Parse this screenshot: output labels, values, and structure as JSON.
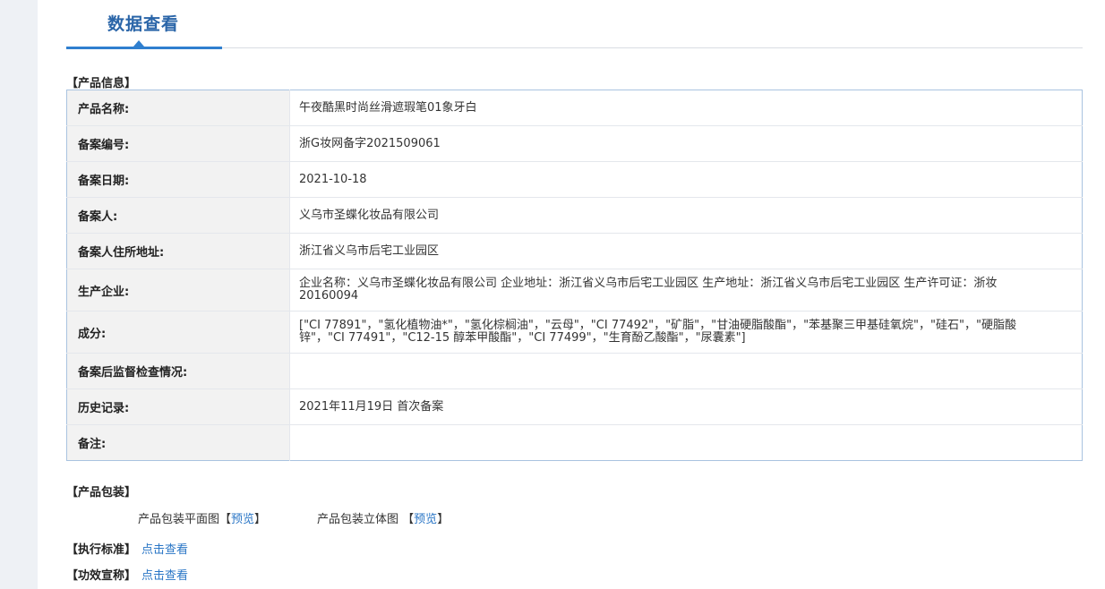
{
  "tab": {
    "title": "数据查看"
  },
  "sections": {
    "product_info": "【产品信息】",
    "packaging": "【产品包装】",
    "standard": "【执行标准】",
    "efficacy": "【功效宣称】"
  },
  "product_info_rows": [
    {
      "key": "产品名称:",
      "value": "午夜酷黑时尚丝滑遮瑕笔01象牙白"
    },
    {
      "key": "备案编号:",
      "value": "浙G妆网备字2021509061"
    },
    {
      "key": "备案日期:",
      "value": "2021-10-18"
    },
    {
      "key": "备案人:",
      "value": "义乌市圣蝶化妆品有限公司"
    },
    {
      "key": "备案人住所地址:",
      "value": "浙江省义乌市后宅工业园区"
    },
    {
      "key": "生产企业:",
      "value": "企业名称：义乌市圣蝶化妆品有限公司 企业地址：浙江省义乌市后宅工业园区 生产地址：浙江省义乌市后宅工业园区 生产许可证：浙妆20160094"
    },
    {
      "key": "成分:",
      "value": "[\"CI 77891\"，\"氢化植物油*\"，\"氢化棕榈油\"，\"云母\"，\"CI 77492\"，\"矿脂\"，\"甘油硬脂酸酯\"，\"苯基聚三甲基硅氧烷\"，\"硅石\"，\"硬脂酸锌\"，\"CI 77491\"，\"C12-15 醇苯甲酸酯\"，\"CI 77499\"，\"生育酚乙酸酯\"，\"尿囊素\"]"
    },
    {
      "key": "备案后监督检查情况:",
      "value": ""
    },
    {
      "key": "历史记录:",
      "value": "2021年11月19日 首次备案"
    },
    {
      "key": "备注:",
      "value": ""
    }
  ],
  "packaging": {
    "flat_label": "产品包装平面图",
    "stereo_label": "产品包装立体图",
    "bracket_open": "【",
    "bracket_close": "】",
    "preview_link": "预览"
  },
  "links": {
    "view": "点击查看"
  }
}
